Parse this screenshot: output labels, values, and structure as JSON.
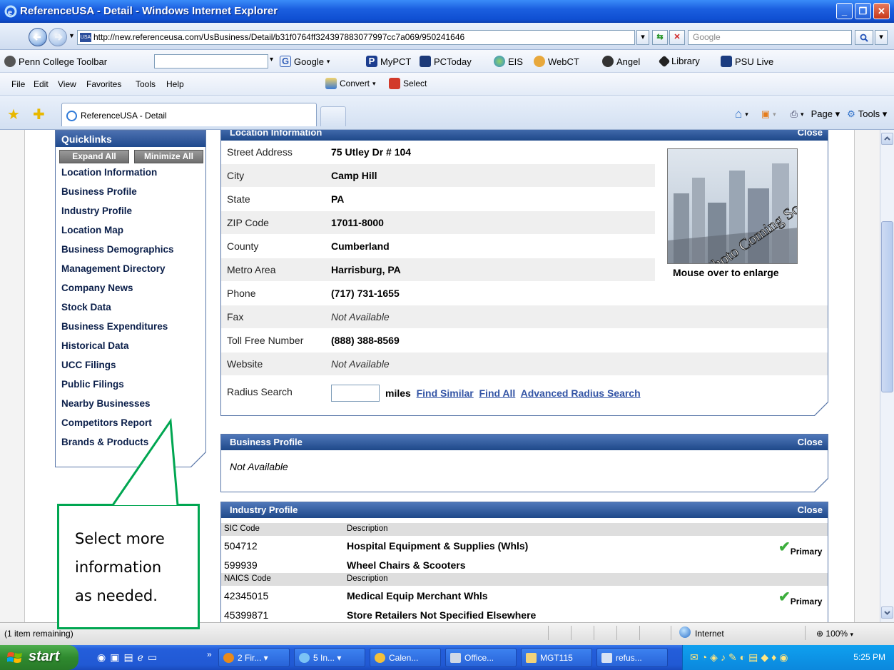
{
  "window": {
    "title": "ReferenceUSA - Detail - Windows Internet Explorer",
    "url": "http://new.referenceusa.com/UsBusiness/Detail/b31f0764ff324397883077997cc7a069/950241646",
    "search_placeholder": "Google"
  },
  "toolbar": {
    "penn": "Penn College Toolbar",
    "google": "Google",
    "items": [
      "MyPCT",
      "PCToday",
      "EIS",
      "WebCT",
      "Angel",
      "Library",
      "PSU Live"
    ],
    "convert": "Convert",
    "select": "Select"
  },
  "menu": [
    "File",
    "Edit",
    "View",
    "Favorites",
    "Tools",
    "Help"
  ],
  "tab": {
    "title": "ReferenceUSA - Detail",
    "page_label": "Page",
    "tools_label": "Tools"
  },
  "quicklinks": {
    "title": "Quicklinks",
    "expand_all": "Expand All",
    "minimize_all": "Minimize All",
    "links": [
      "Location Information",
      "Business Profile",
      "Industry Profile",
      "Location Map",
      "Business Demographics",
      "Management Directory",
      "Company News",
      "Stock Data",
      "Business Expenditures",
      "Historical Data",
      "UCC Filings",
      "Public Filings",
      "Nearby Businesses",
      "Competitors Report",
      "Brands & Products"
    ]
  },
  "location": {
    "title": "Location Information",
    "close": "Close",
    "rows": [
      {
        "label": "Street Address",
        "value": "75 Utley Dr # 104"
      },
      {
        "label": "City",
        "value": "Camp Hill"
      },
      {
        "label": "State",
        "value": "PA"
      },
      {
        "label": "ZIP Code",
        "value": "17011-8000"
      },
      {
        "label": "County",
        "value": "Cumberland"
      },
      {
        "label": "Metro Area",
        "value": "Harrisburg, PA"
      },
      {
        "label": "Phone",
        "value": "(717) 731-1655"
      },
      {
        "label": "Fax",
        "value": "Not Available"
      },
      {
        "label": "Toll Free Number",
        "value": "(888) 388-8569"
      },
      {
        "label": "Website",
        "value": "Not Available"
      }
    ],
    "radius_label": "Radius Search",
    "miles": "miles",
    "find_similar": "Find Similar",
    "find_all": "Find All",
    "advanced": "Advanced Radius Search",
    "photo_text": "Photo Coming Soon",
    "photo_caption": "Mouse over to enlarge"
  },
  "business_profile": {
    "title": "Business Profile",
    "close": "Close",
    "value": "Not Available"
  },
  "industry": {
    "title": "Industry Profile",
    "close": "Close",
    "sic_header": "SIC Code",
    "desc_header": "Description",
    "sic_rows": [
      {
        "code": "504712",
        "desc": "Hospital Equipment & Supplies (Whls)",
        "primary": "Primary"
      },
      {
        "code": "599939",
        "desc": "Wheel Chairs & Scooters"
      }
    ],
    "naics_header": "NAICS Code",
    "naics_rows": [
      {
        "code": "42345015",
        "desc": "Medical Equip Merchant Whls",
        "primary": "Primary"
      },
      {
        "code": "45399871",
        "desc": "Store Retailers Not Specified Elsewhere"
      }
    ]
  },
  "callout": {
    "lines": [
      "Select more",
      "information",
      "as needed."
    ]
  },
  "status": {
    "text": "(1 item remaining)",
    "zone": "Internet",
    "zoom": "100%"
  },
  "taskbar": {
    "start": "start",
    "tasks": [
      "2 Fir...",
      "5 In...",
      "Calen...",
      "Office...",
      "MGT115",
      "refus..."
    ],
    "clock": "5:25 PM"
  },
  "colors": {
    "panel_header": "#1e4889",
    "callout_border": "#00a651",
    "link": "#3354a5"
  }
}
